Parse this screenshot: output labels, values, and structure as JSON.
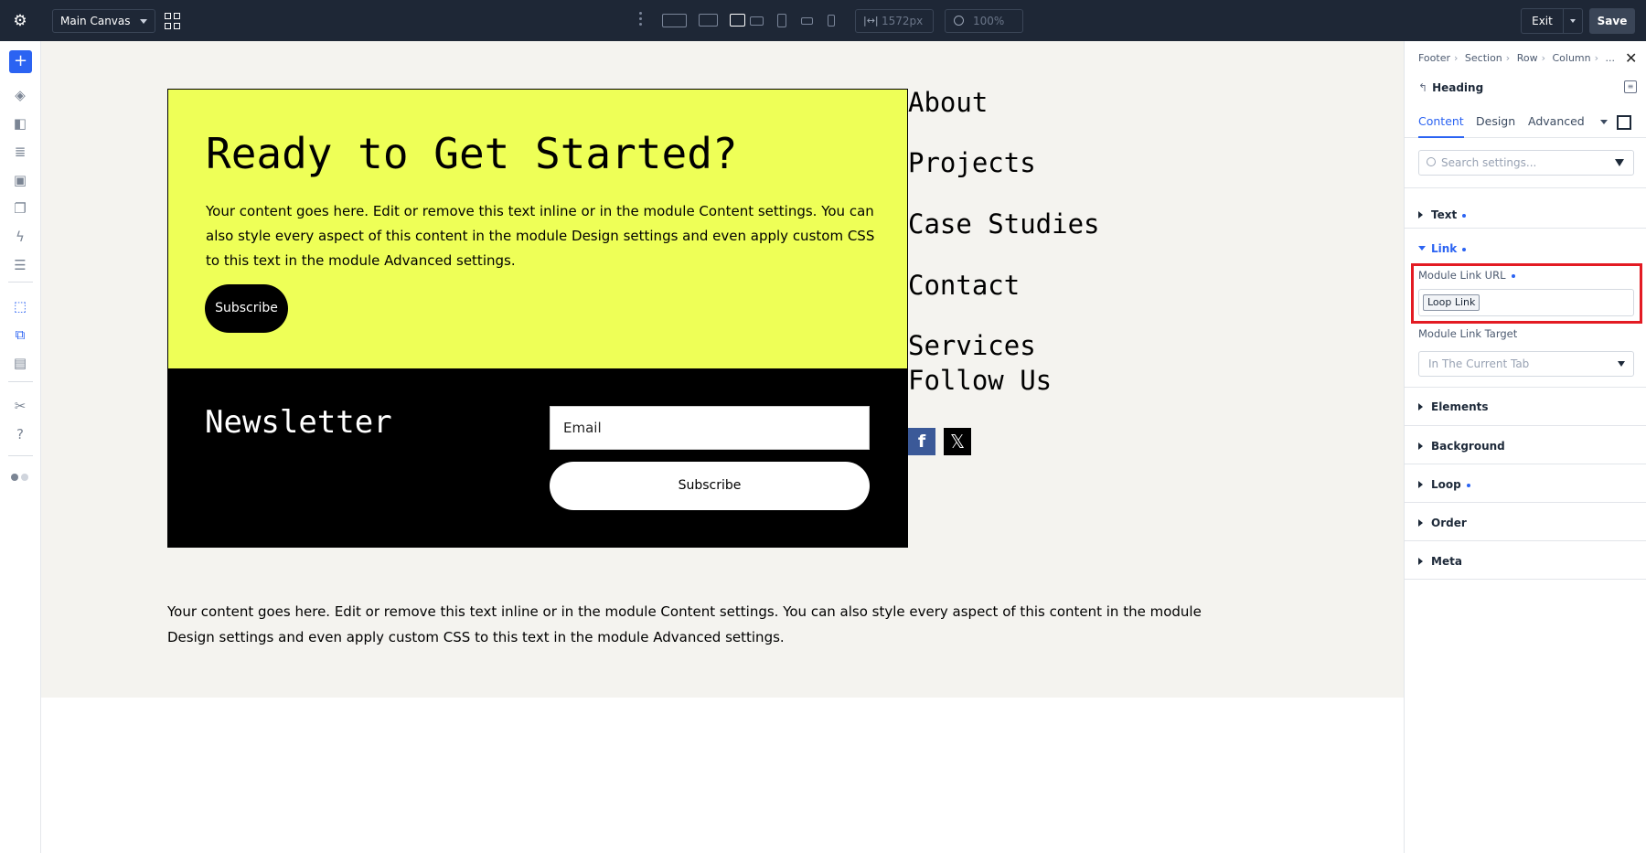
{
  "topbar": {
    "canvas_select": "Main Canvas",
    "width_value": "1572px",
    "zoom_value": "100%",
    "exit_label": "Exit",
    "save_label": "Save"
  },
  "canvas": {
    "hero": {
      "title": "Ready to Get Started?",
      "body": "Your content goes here. Edit or remove this text inline or in the module Content settings. You can also style every aspect of this content in the module Design settings and even apply custom CSS to this text in the module Advanced settings.",
      "button": "Subscribe"
    },
    "newsletter": {
      "title": "Newsletter",
      "email_placeholder": "Email",
      "button": "Subscribe"
    },
    "footer_links": [
      "About",
      "Projects",
      "Case Studies",
      "Contact",
      "Services",
      "Follow Us"
    ],
    "social": {
      "facebook": "f",
      "x": "𝕏"
    },
    "bottom_text": "Your content goes here. Edit or remove this text inline or in the module Content settings. You can also style every aspect of this content in the module Design settings and even apply custom CSS to this text in the module Advanced settings."
  },
  "panel": {
    "breadcrumbs": [
      "Footer",
      "Section",
      "Row",
      "Column",
      "..."
    ],
    "module_name": "Heading",
    "tabs": [
      "Content",
      "Design",
      "Advanced"
    ],
    "active_tab": "Content",
    "search_placeholder": "Search settings...",
    "groups": {
      "text": "Text",
      "link": "Link",
      "elements": "Elements",
      "background": "Background",
      "loop": "Loop",
      "order": "Order",
      "meta": "Meta"
    },
    "link": {
      "url_label": "Module Link URL",
      "url_value": "Loop Link",
      "target_label": "Module Link Target",
      "target_value": "In The Current Tab"
    }
  },
  "colors": {
    "accent": "#2b63f2",
    "topbar": "#1e2736",
    "hero_bg": "#eeff57",
    "highlight": "#e31b23"
  },
  "icons": [
    "gear-icon",
    "grid-icon",
    "add-icon",
    "layers-icon",
    "search-icon",
    "close-icon",
    "filter-icon",
    "facebook-icon",
    "x-icon"
  ]
}
